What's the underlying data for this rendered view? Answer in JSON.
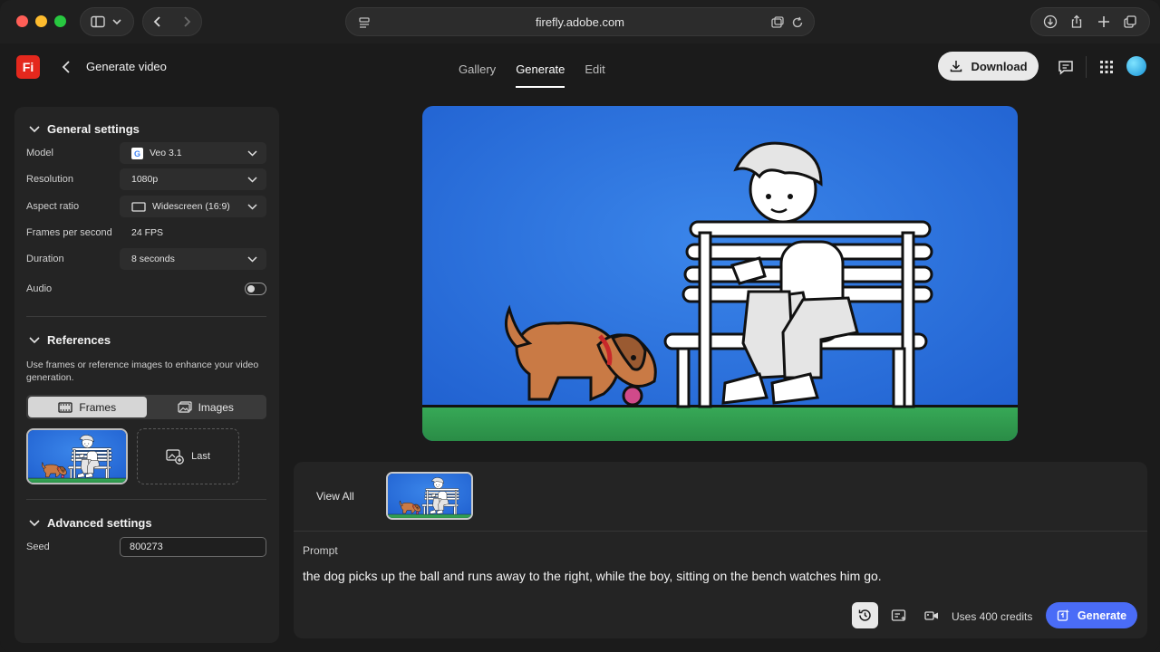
{
  "browser": {
    "url": "firefly.adobe.com",
    "icons": [
      "sidebar-icon",
      "chevron-down-icon",
      "back-arrow-icon",
      "forward-arrow-icon",
      "reader-icon",
      "tab-overview-icon",
      "reload-icon",
      "download-icon",
      "share-icon",
      "new-tab-icon",
      "tabs-icon"
    ]
  },
  "header": {
    "logo": "Fi",
    "title": "Generate video",
    "tabs": [
      {
        "label": "Gallery",
        "active": false
      },
      {
        "label": "Generate",
        "active": true
      },
      {
        "label": "Edit",
        "active": false
      }
    ],
    "download_label": "Download",
    "icons": [
      "comment-icon",
      "apps-grid-icon",
      "avatar"
    ]
  },
  "settings": {
    "general_title": "General settings",
    "model_label": "Model",
    "model_value": "Veo 3.1",
    "resolution_label": "Resolution",
    "resolution_value": "1080p",
    "aspect_label": "Aspect ratio",
    "aspect_value": "Widescreen (16:9)",
    "fps_label": "Frames per second",
    "fps_value": "24 FPS",
    "duration_label": "Duration",
    "duration_value": "8 seconds",
    "audio_label": "Audio",
    "audio_on": false,
    "references_title": "References",
    "references_help": "Use frames or reference images to enhance your video generation.",
    "frames_label": "Frames",
    "images_label": "Images",
    "last_label": "Last",
    "advanced_title": "Advanced settings",
    "seed_label": "Seed",
    "seed_value": "800273"
  },
  "bottom": {
    "view_all": "View All",
    "prompt_label": "Prompt",
    "prompt_text": "the dog picks up the ball and runs away to the right, while the boy, sitting on the bench watches him go.",
    "credits": "Uses 400 credits",
    "generate_label": "Generate"
  },
  "colors": {
    "accent": "#4a6cf7",
    "logo_red": "#e4281d",
    "sky_blue": "#2b6fd8",
    "grass_green": "#2f9a4e"
  }
}
